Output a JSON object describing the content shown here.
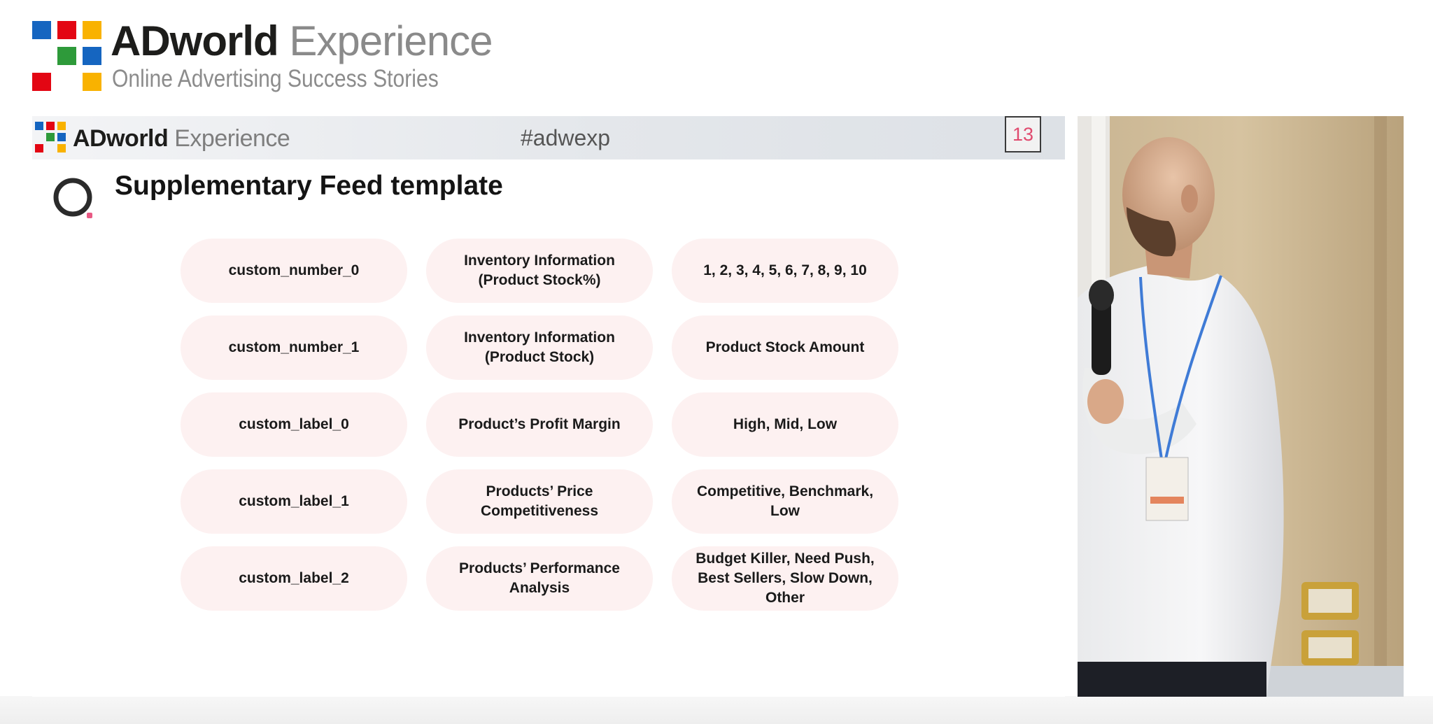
{
  "brand": {
    "title_ad": "ADworld",
    "title_experience": " Experience",
    "subtitle": "Online Advertising Success Stories"
  },
  "slide": {
    "header": {
      "logo_ad": "ADworld",
      "logo_experience": " Experience",
      "hashtag": "#adwexp",
      "page_number": "13"
    },
    "title": "Supplementary Feed template",
    "rows": [
      {
        "field": "custom_number_0",
        "meaning": "Inventory Information (Product Stock%)",
        "values": "1, 2, 3, 4, 5, 6, 7, 8, 9, 10"
      },
      {
        "field": "custom_number_1",
        "meaning": "Inventory Information (Product Stock)",
        "values": "Product Stock Amount"
      },
      {
        "field": "custom_label_0",
        "meaning": "Product’s Profit Margin",
        "values": "High, Mid, Low"
      },
      {
        "field": "custom_label_1",
        "meaning": "Products’ Price Competitiveness",
        "values": "Competitive, Benchmark, Low"
      },
      {
        "field": "custom_label_2",
        "meaning": "Products’ Performance Analysis",
        "values": "Budget Killer, Need Push, Best Sellers, Slow Down, Other"
      }
    ]
  },
  "colors": {
    "mosaic_blue": "#1565c0",
    "mosaic_red": "#e30613",
    "mosaic_yellow": "#f9b200",
    "mosaic_green": "#2e9a3a",
    "page_number_accent": "#e04a6e",
    "cell_background": "#fdf1f1"
  },
  "icons": {
    "title_icon": "ring-icon",
    "photo": "speaker-photo"
  }
}
